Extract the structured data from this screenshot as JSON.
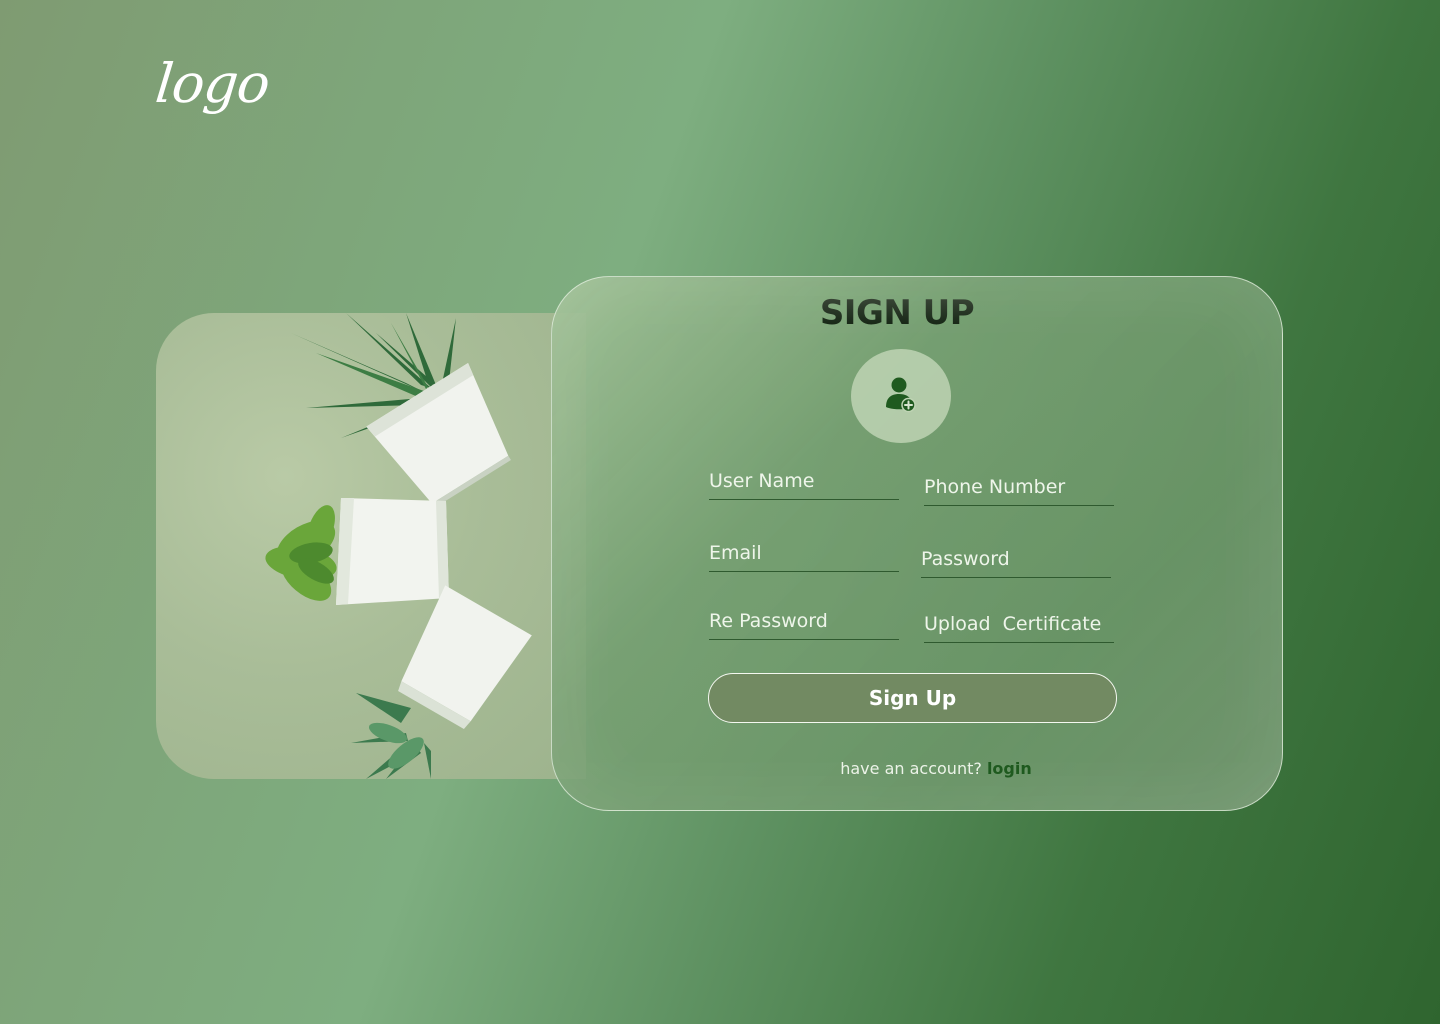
{
  "logo": {
    "text": "logo"
  },
  "form": {
    "title": "SIGN UP",
    "avatar_icon": "user-plus-icon",
    "fields": {
      "user_name": "User Name",
      "phone_number": "Phone Number",
      "email": "Email",
      "password": "Password",
      "re_password": "Re Password",
      "upload_certificate": "Upload  Certificate"
    },
    "submit_label": "Sign Up",
    "footer_text": "have an account?",
    "footer_link": "login"
  },
  "colors": {
    "accent": "#1f5a1f",
    "button": "#728a62"
  }
}
